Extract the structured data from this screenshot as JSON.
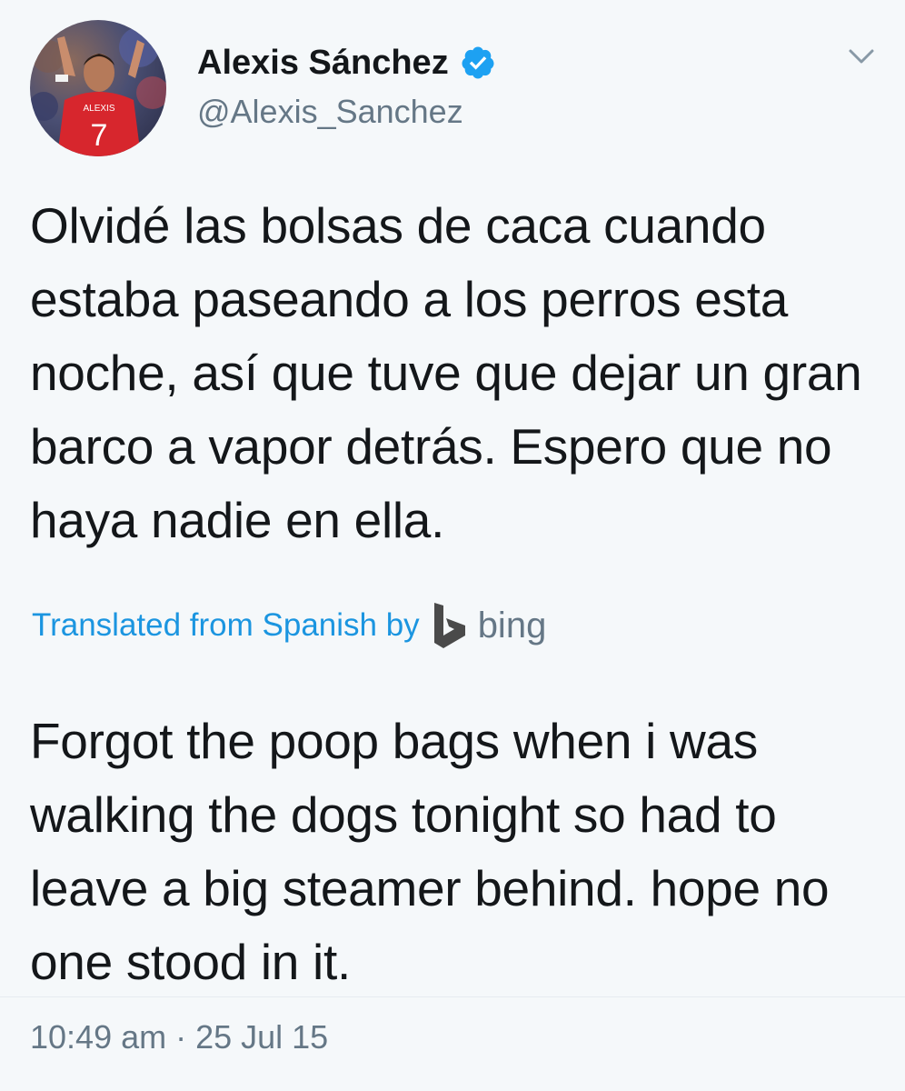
{
  "author": {
    "display_name": "Alexis Sánchez",
    "handle": "@Alexis_Sanchez",
    "verified": true,
    "avatar_jersey_name": "ALEXIS",
    "avatar_jersey_number": "7"
  },
  "tweet": {
    "original_text": "Olvidé las bolsas de caca cuando estaba paseando a los perros esta noche, así que tuve que dejar un gran barco a vapor detrás. Espero que no haya nadie en ella.",
    "translation_notice": "Translated from Spanish by",
    "translation_service": "bing",
    "translated_text": "Forgot the poop bags when i was walking the dogs tonight so had to leave a big steamer behind. hope no one stood in it.",
    "timestamp": "10:49 am · 25 Jul 15"
  },
  "icons": {
    "verified": "verified-badge-icon",
    "menu": "chevron-down-icon",
    "translator": "bing-logo-icon"
  },
  "colors": {
    "background": "#f5f8fa",
    "text": "#14171a",
    "secondary_text": "#657786",
    "link": "#1b95e0",
    "verified_badge": "#1da1f2",
    "bing_logo": "#4a4a4a"
  }
}
